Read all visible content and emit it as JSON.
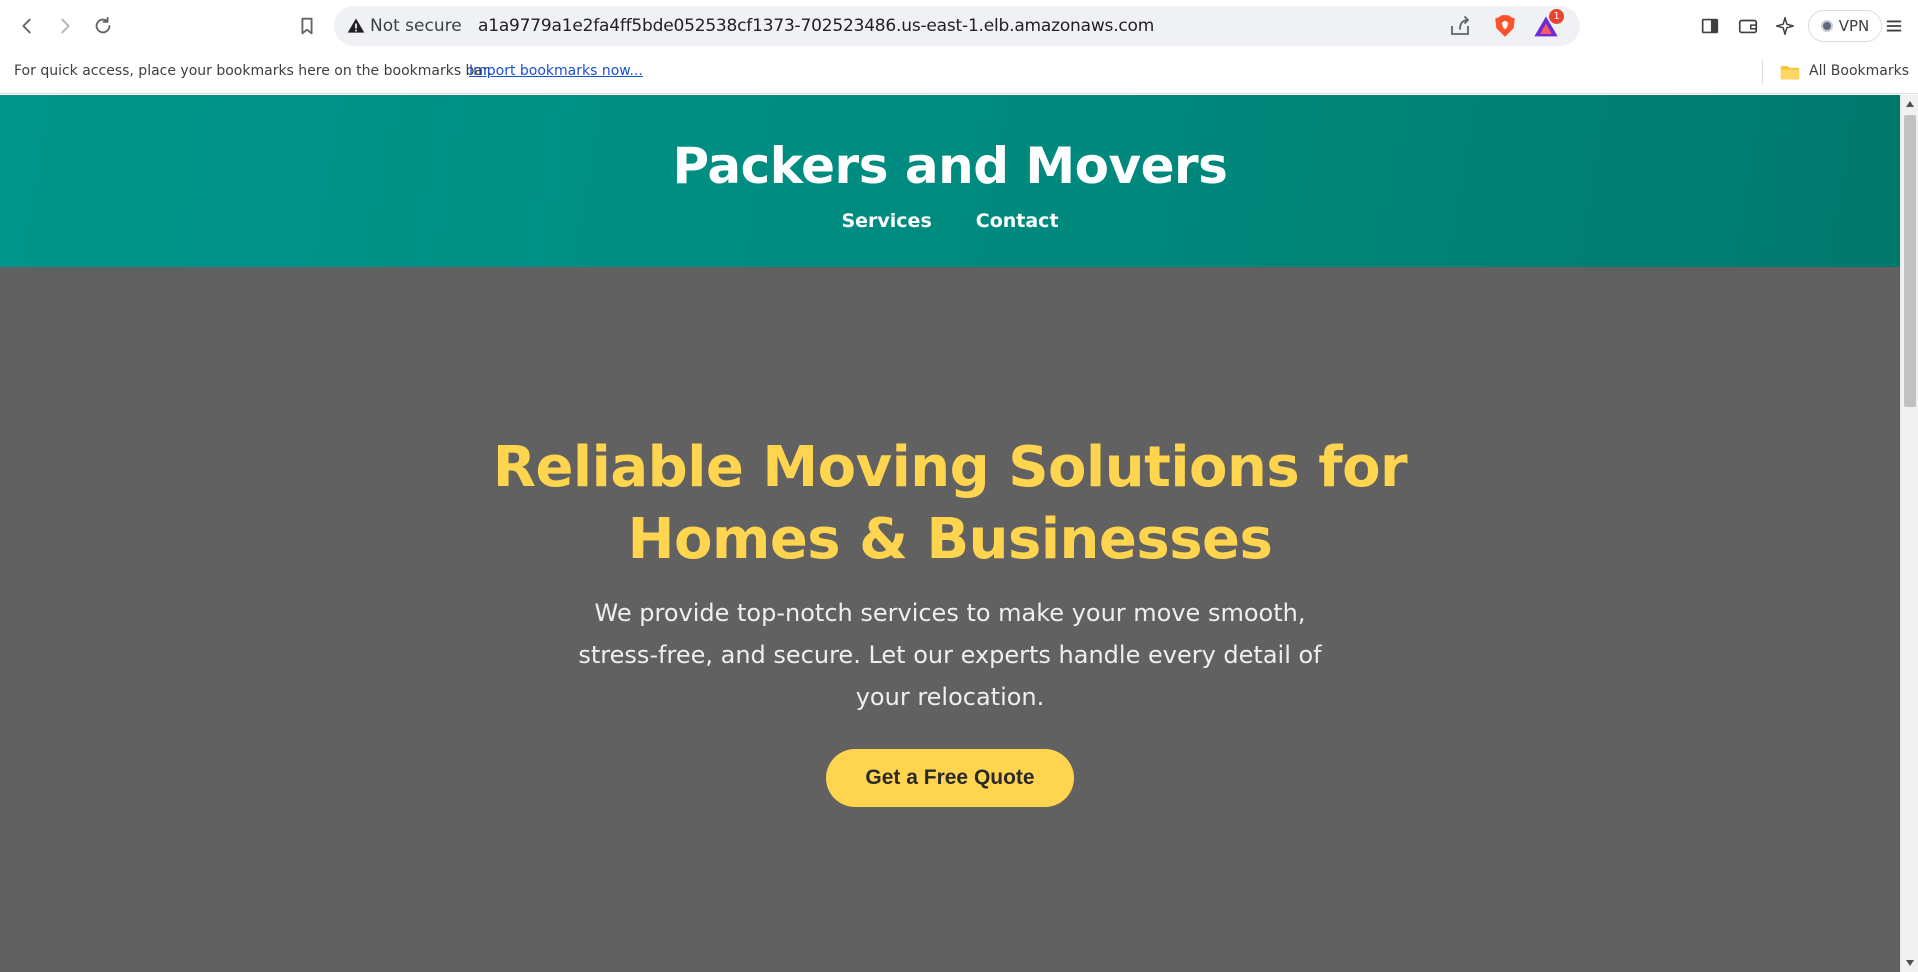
{
  "browser": {
    "security_label": "Not secure",
    "url": "a1a9779a1e2fa4ff5bde052538cf1373-702523486.us-east-1.elb.amazonaws.com",
    "rewards_badge": "1",
    "vpn_label": "VPN",
    "icons": [
      "back-icon",
      "forward-icon",
      "reload-icon",
      "bookmark-icon",
      "warning-icon",
      "share-icon",
      "brave-shields-icon",
      "brave-rewards-icon",
      "sidebar-icon",
      "wallet-icon",
      "leo-ai-icon",
      "menu-icon",
      "folder-icon"
    ]
  },
  "bookmarks_bar": {
    "prompt": "For quick access, place your bookmarks here on the bookmarks bar.",
    "import_link": "Import bookmarks now...",
    "all_bookmarks": "All Bookmarks"
  },
  "site": {
    "title": "Packers and Movers",
    "nav": [
      "Services",
      "Contact"
    ],
    "header_color": "#008a7e"
  },
  "hero": {
    "title": "Reliable Moving Solutions for Homes & Businesses",
    "subtitle": "We provide top-notch services to make your move smooth, stress-free, and secure. Let our experts handle every detail of your relocation.",
    "cta_label": "Get a Free Quote",
    "accent_color": "#ffd54f",
    "background_color": "#616161"
  }
}
